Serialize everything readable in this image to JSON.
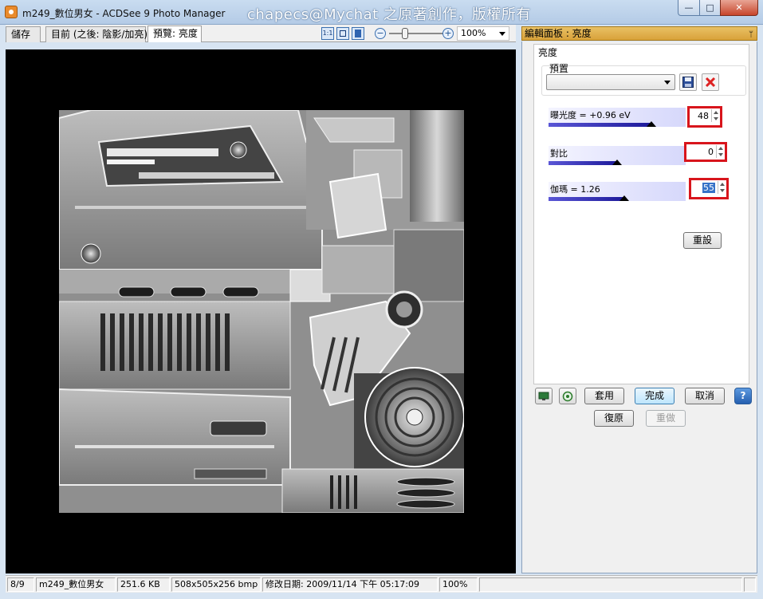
{
  "window": {
    "title": "m249_數位男女 - ACDSee 9 Photo Manager",
    "watermark": "chapecs@Mychat 之原著創作，版權所有",
    "min_glyph": "—",
    "max_glyph": "□",
    "close_glyph": "✕"
  },
  "tabs": [
    {
      "label": "儲存"
    },
    {
      "label": "目前 (之後: 陰影/加亮)"
    },
    {
      "label": "預覽: 亮度"
    }
  ],
  "toolbar": {
    "actual_size_glyph": "1:1",
    "zoom_minus": "−",
    "zoom_plus": "+",
    "zoom_level": "100%",
    "zoom_slider": 0.3
  },
  "panel": {
    "header": "編輯面板 : 亮度",
    "pin_glyph": "ᛘ",
    "group_title": "亮度",
    "preset_label": "預置",
    "preset_value": "",
    "sliders": [
      {
        "label": "曝光度 = +0.96 eV",
        "value": "48",
        "fill": 0.75,
        "selected": false
      },
      {
        "label": "對比",
        "value": "0",
        "fill": 0.5,
        "selected": false
      },
      {
        "label": "伽瑪 = 1.26",
        "value": "55",
        "fill": 0.55,
        "selected": true
      }
    ],
    "reset_label": "重設",
    "apply_label": "套用",
    "done_label": "完成",
    "cancel_label": "取消",
    "help_glyph": "?",
    "undo_label": "復原",
    "redo_label": "重做"
  },
  "statusbar": {
    "index": "8/9",
    "filename": "m249_數位男女",
    "filesize": "251.6 KB",
    "dimensions": "508x505x256 bmp",
    "modified": "修改日期: 2009/11/14 下午 05:17:09",
    "zoom": "100%"
  }
}
